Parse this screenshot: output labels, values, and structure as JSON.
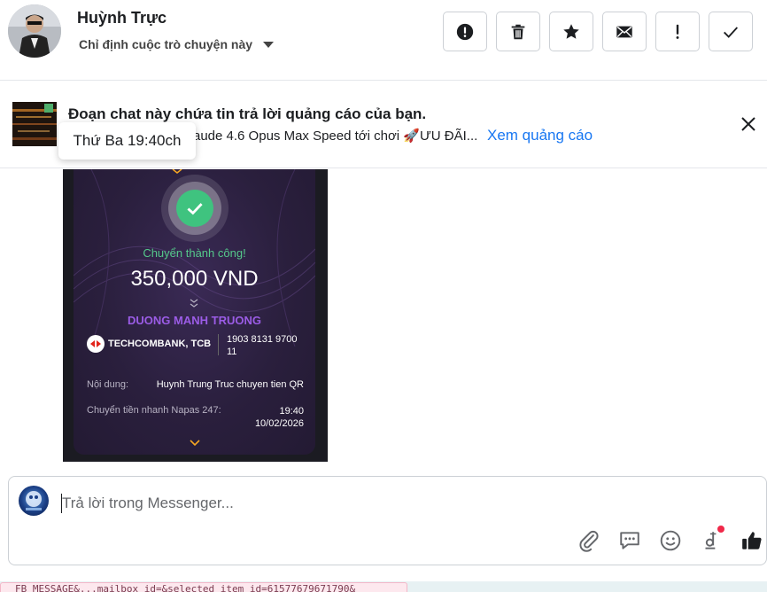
{
  "header": {
    "contact_name": "Huỳnh Trực",
    "assign_label": "Chỉ định cuộc trò chuyện này",
    "actions": [
      {
        "name": "spam",
        "icon": "alert-circle-icon"
      },
      {
        "name": "delete",
        "icon": "trash-icon"
      },
      {
        "name": "star",
        "icon": "star-icon"
      },
      {
        "name": "mark-unread",
        "icon": "envelope-icon"
      },
      {
        "name": "important",
        "icon": "exclamation-icon"
      },
      {
        "name": "done",
        "icon": "checkmark-icon"
      }
    ]
  },
  "ad_banner": {
    "title": "Đoạn chat này chứa tin trả lời quảng cáo của bạn.",
    "subtitle": "aude 4.6 Opus Max Speed tới chơi 🚀ƯU ĐÃI...",
    "link": "Xem quảng cáo",
    "tooltip": "Thứ Ba 19:40ch"
  },
  "receipt": {
    "status": "Chuyển thành công!",
    "amount": "350,000 VND",
    "recipient": "DUONG MANH TRUONG",
    "bank": "TECHCOMBANK, TCB",
    "account": "1903 8131 9700 11",
    "content_label": "Nội dung:",
    "content_value": "Huynh Trung Truc chuyen tien QR",
    "transfer_label": "Chuyển tiền nhanh Napas 247:",
    "time": "19:40",
    "date": "10/02/2026",
    "colors": {
      "success": "#55c98b",
      "recipient": "#9b5ce6",
      "accent": "#f5a623"
    }
  },
  "composer": {
    "placeholder": "Trả lời trong Messenger...",
    "tools": [
      "paperclip-icon",
      "saved-replies-icon",
      "emoji-icon",
      "currency-icon",
      "thumbs-up-icon"
    ]
  },
  "bottom_bar": {
    "text": "FB_MESSAGE&...mailbox_id=&selected_item_id=61577679671790&"
  },
  "colors": {
    "link": "#1877f2",
    "border": "#ccd0d5",
    "notification_dot": "#f02849"
  }
}
